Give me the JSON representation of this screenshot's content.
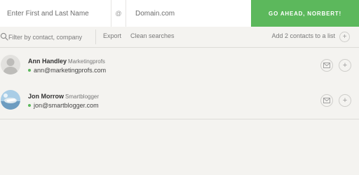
{
  "search": {
    "name_placeholder": "Enter First and Last Name",
    "at_symbol": "@",
    "domain_placeholder": "Domain.com",
    "go_label": "GO AHEAD, NORBERT!"
  },
  "toolbar": {
    "filter_placeholder": "Filter by contact, company",
    "export_label": "Export",
    "clean_label": "Clean searches",
    "add_list_label": "Add 2 contacts to a list",
    "add_list_icon": "+"
  },
  "contacts": [
    {
      "name": "Ann Handley",
      "company": "Marketingprofs",
      "email": "ann@marketingprofs.com",
      "avatar": "default-person-avatar",
      "status": "verified"
    },
    {
      "name": "Jon Morrow",
      "company": "Smartblogger",
      "email": "jon@smartblogger.com",
      "avatar": "photo-avatar",
      "status": "verified"
    }
  ],
  "row_actions": {
    "mail_icon": "envelope-icon",
    "add_icon": "+"
  },
  "colors": {
    "accent": "#5cb85c",
    "background": "#f4f3f0",
    "input_background": "#ffffff"
  }
}
